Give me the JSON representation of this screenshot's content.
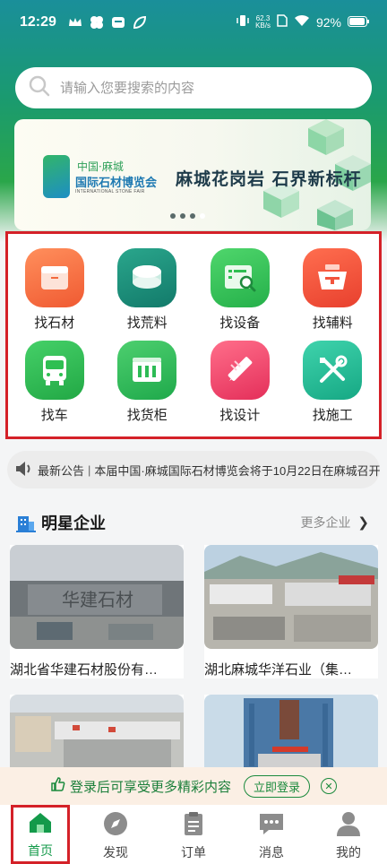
{
  "status_bar": {
    "time": "12:29",
    "net_speed_value": "62.3",
    "net_speed_unit": "KB/s",
    "battery": "92%"
  },
  "search": {
    "placeholder": "请输入您要搜索的内容"
  },
  "banner": {
    "logo_line1": "中国·麻城",
    "logo_line2": "国际石材博览会",
    "logo_line3": "INTERNATIONAL STONE FAIR",
    "slogan": "麻城花岗岩 石界新标杆",
    "dots": 4,
    "active_dot": 4
  },
  "categories": [
    {
      "label": "找石材",
      "icon": "box-icon",
      "color": "#f26a3e"
    },
    {
      "label": "找荒料",
      "icon": "stone-slab-icon",
      "color": "#1e9b82"
    },
    {
      "label": "找设备",
      "icon": "equipment-search-icon",
      "color": "#3cc45a"
    },
    {
      "label": "找辅料",
      "icon": "basket-icon",
      "color": "#f2543d"
    },
    {
      "label": "找车",
      "icon": "bus-icon",
      "color": "#2fbf52"
    },
    {
      "label": "找货柜",
      "icon": "container-icon",
      "color": "#2dbb55"
    },
    {
      "label": "找设计",
      "icon": "ruler-pencil-icon",
      "color": "#ec3f6a"
    },
    {
      "label": "找施工",
      "icon": "tools-icon",
      "color": "#27bf9a"
    }
  ],
  "notice": {
    "prefix": "最新公告",
    "text": "本届中国·麻城国际石材博览会将于10月22日在麻城召开"
  },
  "featured": {
    "title": "明星企业",
    "more_label": "更多企业",
    "companies": [
      {
        "name": "湖北省华建石材股份有…",
        "sign": "华建石材"
      },
      {
        "name": "湖北麻城华洋石业（集…"
      },
      {
        "name": ""
      },
      {
        "name": ""
      }
    ]
  },
  "login_bar": {
    "text": "登录后可享受更多精彩内容",
    "button": "立即登录"
  },
  "tabbar": [
    {
      "label": "首页",
      "icon": "home-icon"
    },
    {
      "label": "发现",
      "icon": "compass-icon"
    },
    {
      "label": "订单",
      "icon": "clipboard-icon"
    },
    {
      "label": "消息",
      "icon": "chat-icon"
    },
    {
      "label": "我的",
      "icon": "person-icon"
    }
  ],
  "colors": {
    "brand_green": "#139a4a",
    "highlight_red": "#d42128"
  }
}
